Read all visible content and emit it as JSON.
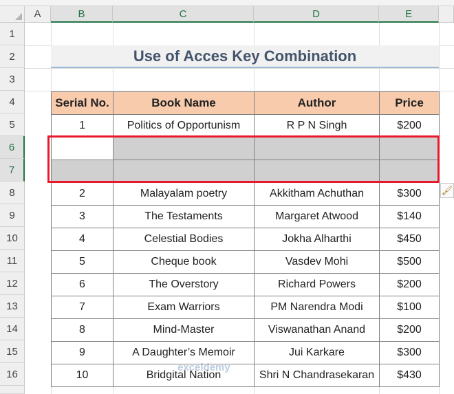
{
  "columns": [
    "A",
    "B",
    "C",
    "D",
    "E"
  ],
  "rows": [
    "1",
    "2",
    "3",
    "4",
    "5",
    "6",
    "7",
    "8",
    "9",
    "10",
    "11",
    "12",
    "13",
    "14",
    "15",
    "16"
  ],
  "title": "Use of Acces Key Combination",
  "headers": {
    "serial": "Serial No.",
    "book": "Book Name",
    "author": "Author",
    "price": "Price"
  },
  "books": [
    {
      "serial": "1",
      "book": "Politics of Opportunism",
      "author": "R P N Singh",
      "price": "$200"
    },
    {
      "serial": "2",
      "book": "Malayalam poetry",
      "author": "Akkitham Achuthan",
      "price": "$300"
    },
    {
      "serial": "3",
      "book": "The Testaments",
      "author": "Margaret Atwood",
      "price": "$140"
    },
    {
      "serial": "4",
      "book": "Celestial Bodies",
      "author": "Jokha Alharthi",
      "price": "$450"
    },
    {
      "serial": "5",
      "book": "Cheque book",
      "author": "Vasdev Mohi",
      "price": "$500"
    },
    {
      "serial": "6",
      "book": "The Overstory",
      "author": "Richard Powers",
      "price": "$200"
    },
    {
      "serial": "7",
      "book": "Exam Warriors",
      "author": "PM Narendra Modi",
      "price": "$100"
    },
    {
      "serial": "8",
      "book": "Mind-Master",
      "author": "Viswanathan Anand",
      "price": "$200"
    },
    {
      "serial": "9",
      "book": "A Daughter’s Memoir",
      "author": "Jui Karkare",
      "price": "$300"
    },
    {
      "serial": "10",
      "book": "Bridgital Nation",
      "author": "Shri N Chandrasekaran",
      "price": "$430"
    }
  ],
  "icons": {
    "insert_options": "paint-brush-icon"
  },
  "watermark": "exceldemy",
  "colors": {
    "header_fill": "#f8cbad",
    "selection_fill": "#d0d0d0",
    "highlight_box": "#e8192c",
    "title_text": "#44546a"
  }
}
